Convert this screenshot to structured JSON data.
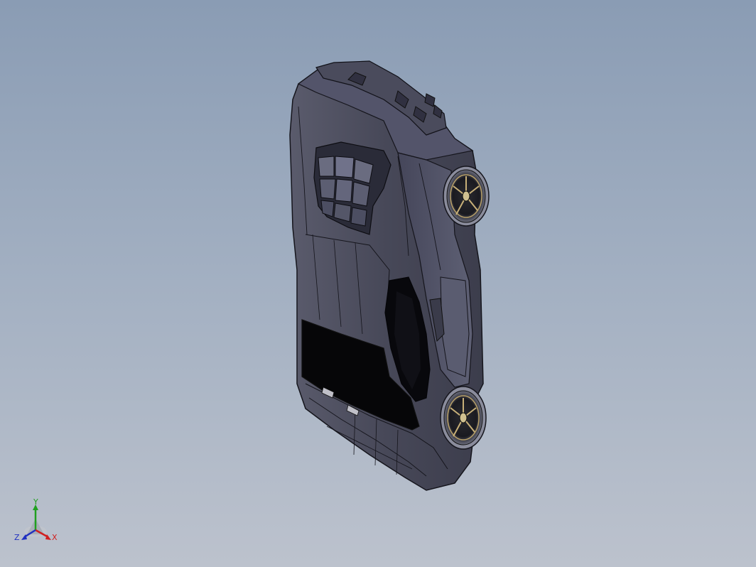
{
  "viewport": {
    "background_top": "#8a9cb4",
    "background_bottom": "#bcc2cd",
    "model": {
      "description_icon": "car-3d-model",
      "body_color": "#4a4b5a",
      "edge_color": "#1a1a22",
      "glass_color": "#0a0a0e",
      "rim_color": "#b8a068"
    }
  },
  "triad": {
    "x_label": "X",
    "y_label": "Y",
    "z_label": "Z",
    "x_color": "#d02020",
    "y_color": "#20a020",
    "z_color": "#2030c0"
  }
}
